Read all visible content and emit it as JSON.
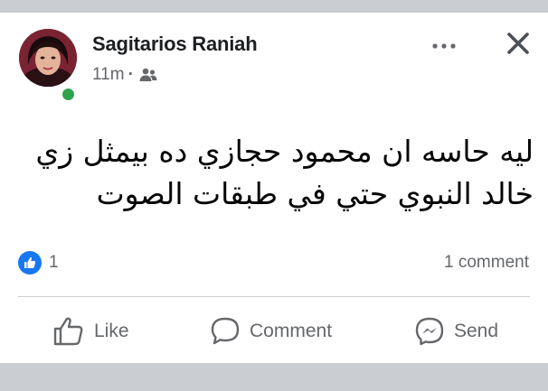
{
  "post": {
    "author": "Sagitarios Raniah",
    "time": "11m",
    "separator": "·",
    "audience_icon": "friends-icon",
    "text": "ليه حاسه ان محمود حجازي ده بيمثل زي خالد النبوي حتي في طبقات الصوت"
  },
  "reactions": {
    "icon": "like-reaction-icon",
    "count": "1"
  },
  "comments": {
    "count_label": "1 comment"
  },
  "actions": {
    "like_label": "Like",
    "comment_label": "Comment",
    "send_label": "Send"
  },
  "colors": {
    "online": "#31a24c",
    "like_blue": "#1877f2",
    "secondary_text": "#65676b"
  }
}
